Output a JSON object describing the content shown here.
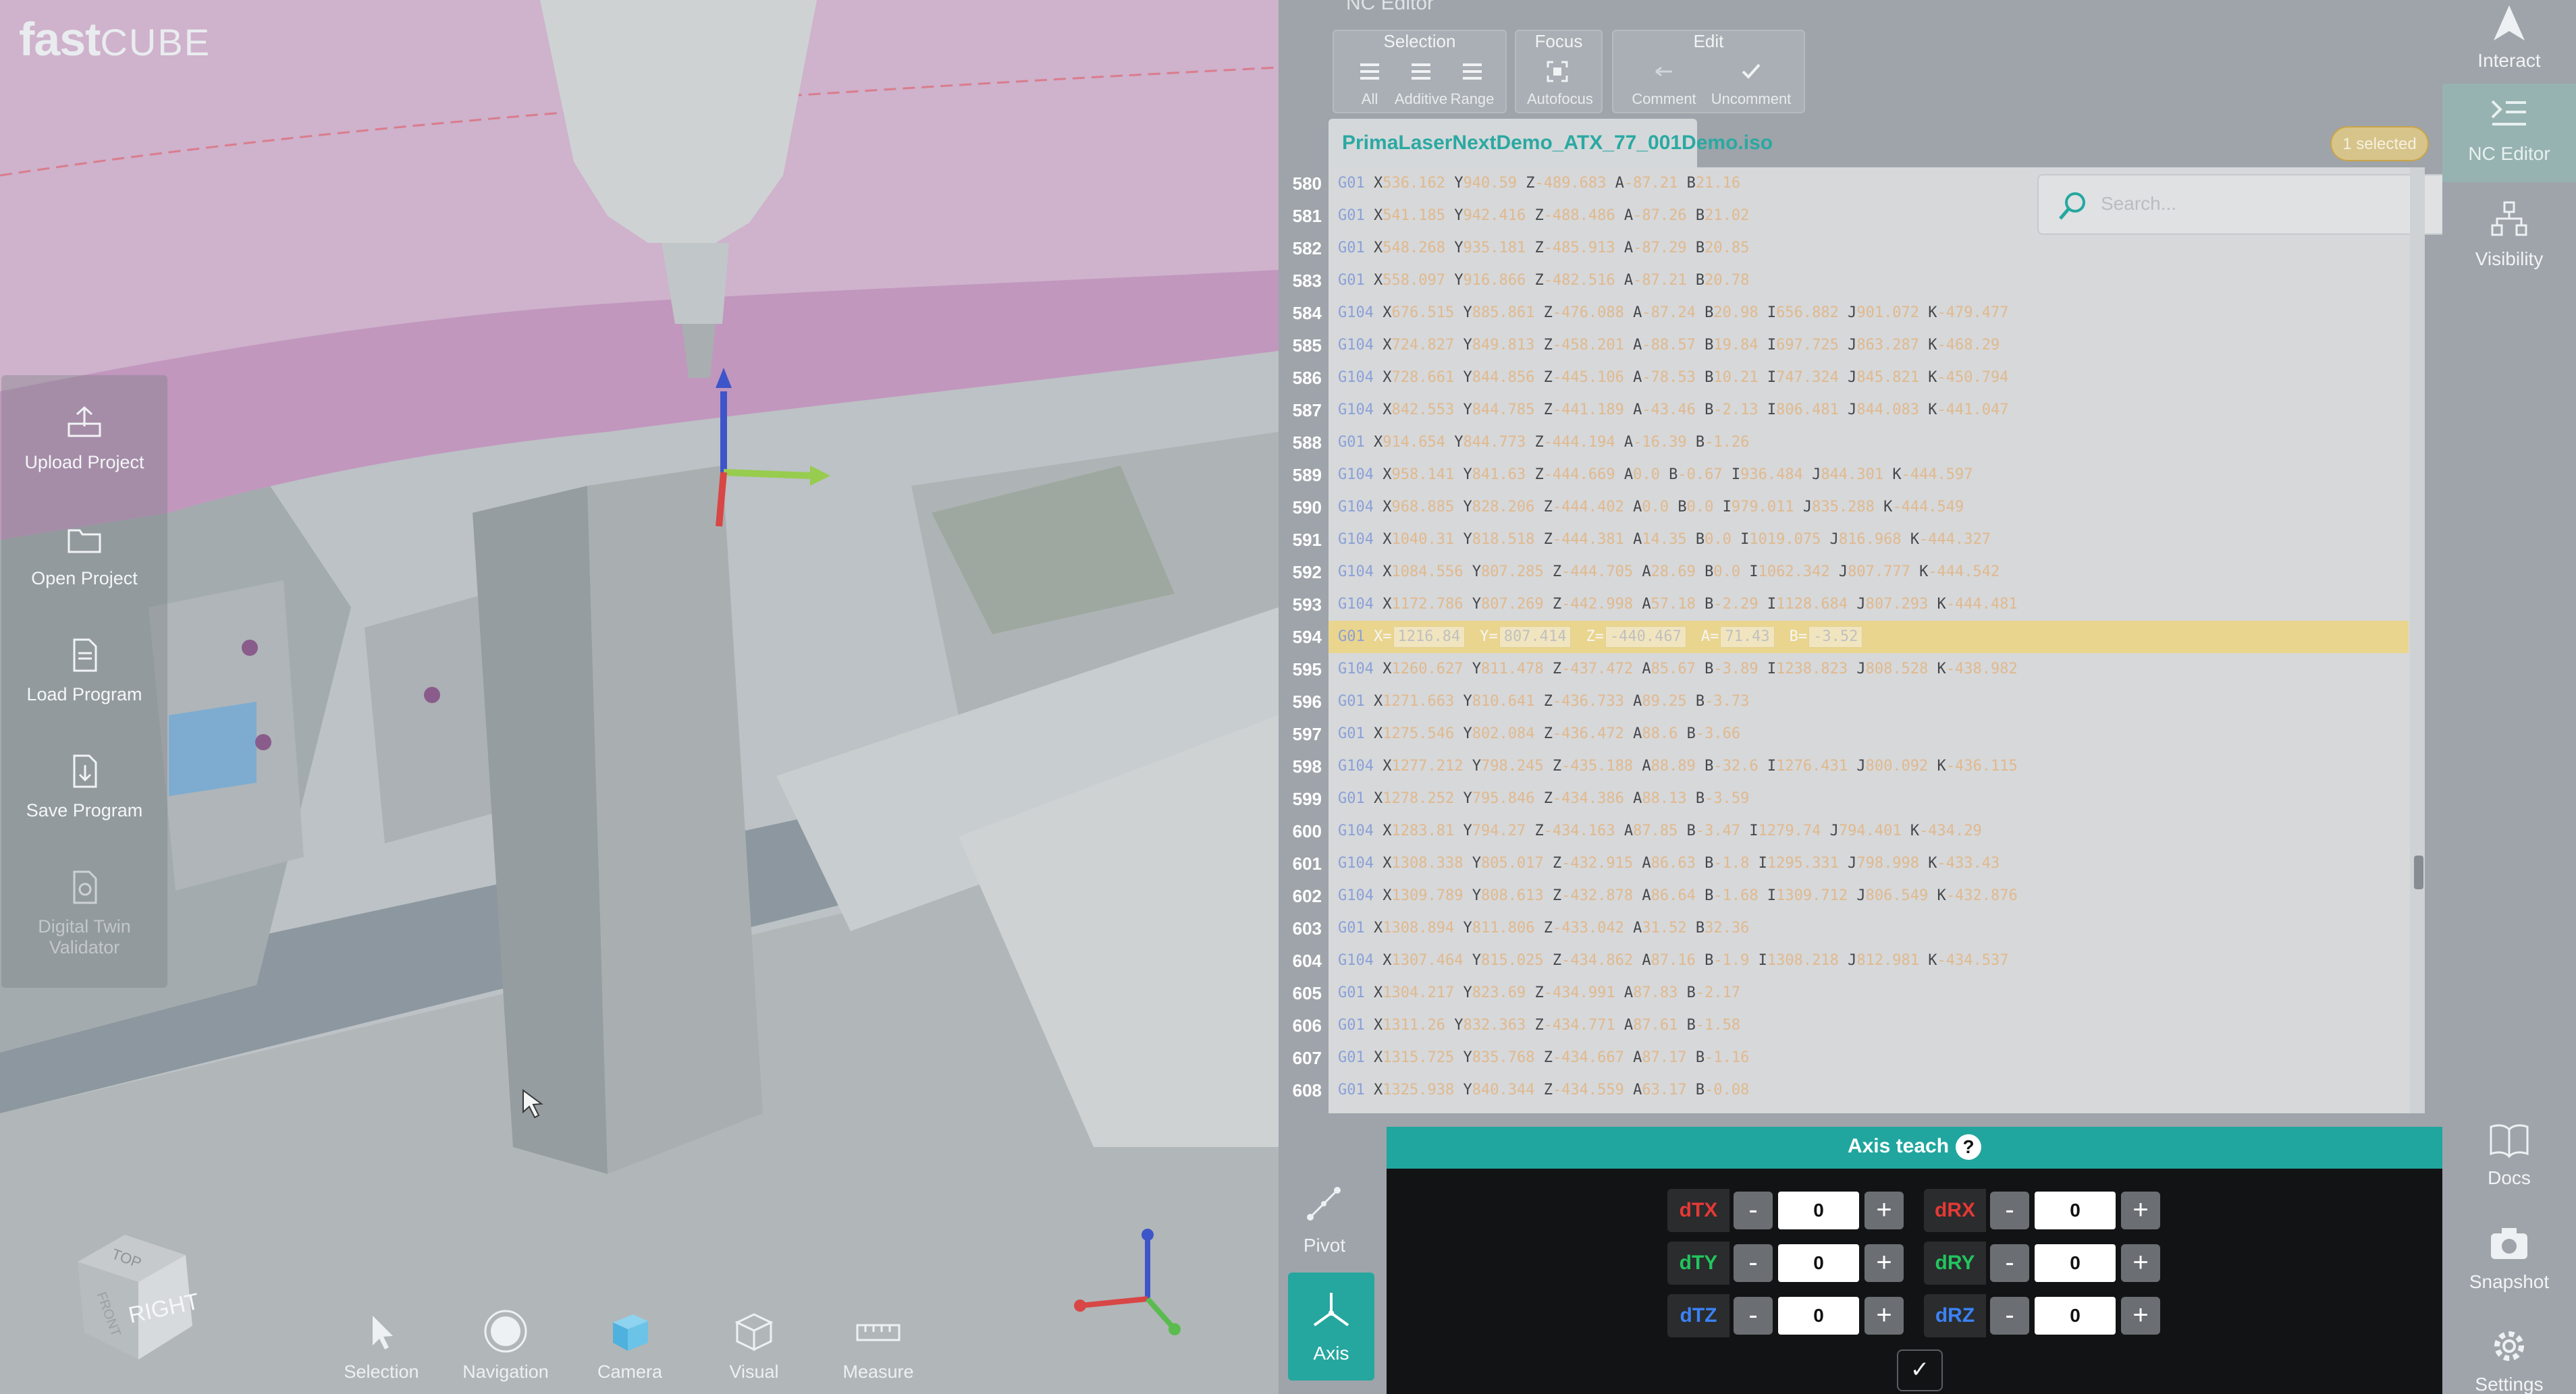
{
  "brand": {
    "name_left": "fast",
    "name_right": "CUBE"
  },
  "left_panel": [
    {
      "label": "Upload Project",
      "icon": "upload-project-icon"
    },
    {
      "label": "Open Project",
      "icon": "folder-icon"
    },
    {
      "label": "Load Program",
      "icon": "document-icon"
    },
    {
      "label": "Save Program",
      "icon": "save-program-icon"
    },
    {
      "label": "Digital Twin Validator",
      "icon": "digital-twin-icon"
    }
  ],
  "bottom_toolbar": [
    {
      "label": "Selection",
      "icon": "cursor-icon"
    },
    {
      "label": "Navigation",
      "icon": "navigation-icon"
    },
    {
      "label": "Camera",
      "icon": "camera-cube-icon"
    },
    {
      "label": "Visual",
      "icon": "visual-box-icon"
    },
    {
      "label": "Measure",
      "icon": "ruler-icon"
    }
  ],
  "nav_cube": {
    "face_front": "RIGHT",
    "face_top": "TOP",
    "face_side": "FRONT"
  },
  "nc_toolbar": {
    "title": "NC Editor",
    "groups": [
      {
        "title": "Selection",
        "buttons": [
          "All",
          "Additive",
          "Range"
        ]
      },
      {
        "title": "Focus",
        "buttons": [
          "Autofocus"
        ]
      },
      {
        "title": "Edit",
        "buttons": [
          "Comment",
          "Uncomment"
        ]
      }
    ]
  },
  "file_tab": "PrimaLaserNextDemo_ATX_77_001Demo.iso",
  "selected_badge": "1 selected",
  "search": {
    "placeholder": "Search..."
  },
  "code_lines": [
    {
      "n": "580",
      "g": "G01",
      "words": [
        [
          "X",
          "536.162"
        ],
        [
          "Y",
          "940.59"
        ],
        [
          "Z",
          "-489.683"
        ],
        [
          "A",
          "-87.21"
        ],
        [
          "B",
          "21.16"
        ]
      ]
    },
    {
      "n": "581",
      "g": "G01",
      "words": [
        [
          "X",
          "541.185"
        ],
        [
          "Y",
          "942.416"
        ],
        [
          "Z",
          "-488.486"
        ],
        [
          "A",
          "-87.26"
        ],
        [
          "B",
          "21.02"
        ]
      ]
    },
    {
      "n": "582",
      "g": "G01",
      "words": [
        [
          "X",
          "548.268"
        ],
        [
          "Y",
          "935.181"
        ],
        [
          "Z",
          "-485.913"
        ],
        [
          "A",
          "-87.29"
        ],
        [
          "B",
          "20.85"
        ]
      ]
    },
    {
      "n": "583",
      "g": "G01",
      "words": [
        [
          "X",
          "558.097"
        ],
        [
          "Y",
          "916.866"
        ],
        [
          "Z",
          "-482.516"
        ],
        [
          "A",
          "-87.21"
        ],
        [
          "B",
          "20.78"
        ]
      ]
    },
    {
      "n": "584",
      "g": "G104",
      "words": [
        [
          "X",
          "676.515"
        ],
        [
          "Y",
          "885.861"
        ],
        [
          "Z",
          "-476.088"
        ],
        [
          "A",
          "-87.24"
        ],
        [
          "B",
          "20.98"
        ],
        [
          "I",
          "656.882"
        ],
        [
          "J",
          "901.072"
        ],
        [
          "K",
          "-479.477"
        ]
      ]
    },
    {
      "n": "585",
      "g": "G104",
      "words": [
        [
          "X",
          "724.827"
        ],
        [
          "Y",
          "849.813"
        ],
        [
          "Z",
          "-458.201"
        ],
        [
          "A",
          "-88.57"
        ],
        [
          "B",
          "19.84"
        ],
        [
          "I",
          "697.725"
        ],
        [
          "J",
          "863.287"
        ],
        [
          "K",
          "-468.29"
        ]
      ]
    },
    {
      "n": "586",
      "g": "G104",
      "words": [
        [
          "X",
          "728.661"
        ],
        [
          "Y",
          "844.856"
        ],
        [
          "Z",
          "-445.106"
        ],
        [
          "A",
          "-78.53"
        ],
        [
          "B",
          "10.21"
        ],
        [
          "I",
          "747.324"
        ],
        [
          "J",
          "845.821"
        ],
        [
          "K",
          "-450.794"
        ]
      ]
    },
    {
      "n": "587",
      "g": "G104",
      "words": [
        [
          "X",
          "842.553"
        ],
        [
          "Y",
          "844.785"
        ],
        [
          "Z",
          "-441.189"
        ],
        [
          "A",
          "-43.46"
        ],
        [
          "B",
          "-2.13"
        ],
        [
          "I",
          "806.481"
        ],
        [
          "J",
          "844.083"
        ],
        [
          "K",
          "-441.047"
        ]
      ]
    },
    {
      "n": "588",
      "g": "G01",
      "words": [
        [
          "X",
          "914.654"
        ],
        [
          "Y",
          "844.773"
        ],
        [
          "Z",
          "-444.194"
        ],
        [
          "A",
          "-16.39"
        ],
        [
          "B",
          "-1.26"
        ]
      ]
    },
    {
      "n": "589",
      "g": "G104",
      "words": [
        [
          "X",
          "958.141"
        ],
        [
          "Y",
          "841.63"
        ],
        [
          "Z",
          "-444.669"
        ],
        [
          "A",
          "0.0"
        ],
        [
          "B",
          "-0.67"
        ],
        [
          "I",
          "936.484"
        ],
        [
          "J",
          "844.301"
        ],
        [
          "K",
          "-444.597"
        ]
      ]
    },
    {
      "n": "590",
      "g": "G104",
      "words": [
        [
          "X",
          "968.885"
        ],
        [
          "Y",
          "828.206"
        ],
        [
          "Z",
          "-444.402"
        ],
        [
          "A",
          "0.0"
        ],
        [
          "B",
          "0.0"
        ],
        [
          "I",
          "979.011"
        ],
        [
          "J",
          "835.288"
        ],
        [
          "K",
          "-444.549"
        ]
      ]
    },
    {
      "n": "591",
      "g": "G104",
      "words": [
        [
          "X",
          "1040.31"
        ],
        [
          "Y",
          "818.518"
        ],
        [
          "Z",
          "-444.381"
        ],
        [
          "A",
          "14.35"
        ],
        [
          "B",
          "0.0"
        ],
        [
          "I",
          "1019.075"
        ],
        [
          "J",
          "816.968"
        ],
        [
          "K",
          "-444.327"
        ]
      ]
    },
    {
      "n": "592",
      "g": "G104",
      "words": [
        [
          "X",
          "1084.556"
        ],
        [
          "Y",
          "807.285"
        ],
        [
          "Z",
          "-444.705"
        ],
        [
          "A",
          "28.69"
        ],
        [
          "B",
          "0.0"
        ],
        [
          "I",
          "1062.342"
        ],
        [
          "J",
          "807.777"
        ],
        [
          "K",
          "-444.542"
        ]
      ]
    },
    {
      "n": "593",
      "g": "G104",
      "words": [
        [
          "X",
          "1172.786"
        ],
        [
          "Y",
          "807.269"
        ],
        [
          "Z",
          "-442.998"
        ],
        [
          "A",
          "57.18"
        ],
        [
          "B",
          "-2.29"
        ],
        [
          "I",
          "1128.684"
        ],
        [
          "J",
          "807.293"
        ],
        [
          "K",
          "-444.481"
        ]
      ]
    },
    {
      "n": "594",
      "g": "G01",
      "highlight": true,
      "words": [
        [
          "X",
          "1216.84"
        ],
        [
          "Y",
          "807.414"
        ],
        [
          "Z",
          "-440.467"
        ],
        [
          "A",
          "71.43"
        ],
        [
          "B",
          "-3.52"
        ]
      ]
    },
    {
      "n": "595",
      "g": "G104",
      "words": [
        [
          "X",
          "1260.627"
        ],
        [
          "Y",
          "811.478"
        ],
        [
          "Z",
          "-437.472"
        ],
        [
          "A",
          "85.67"
        ],
        [
          "B",
          "-3.89"
        ],
        [
          "I",
          "1238.823"
        ],
        [
          "J",
          "808.528"
        ],
        [
          "K",
          "-438.982"
        ]
      ]
    },
    {
      "n": "596",
      "g": "G01",
      "words": [
        [
          "X",
          "1271.663"
        ],
        [
          "Y",
          "810.641"
        ],
        [
          "Z",
          "-436.733"
        ],
        [
          "A",
          "89.25"
        ],
        [
          "B",
          "-3.73"
        ]
      ]
    },
    {
      "n": "597",
      "g": "G01",
      "words": [
        [
          "X",
          "1275.546"
        ],
        [
          "Y",
          "802.084"
        ],
        [
          "Z",
          "-436.472"
        ],
        [
          "A",
          "88.6"
        ],
        [
          "B",
          "-3.66"
        ]
      ]
    },
    {
      "n": "598",
      "g": "G104",
      "words": [
        [
          "X",
          "1277.212"
        ],
        [
          "Y",
          "798.245"
        ],
        [
          "Z",
          "-435.188"
        ],
        [
          "A",
          "88.89"
        ],
        [
          "B",
          "-32.6"
        ],
        [
          "I",
          "1276.431"
        ],
        [
          "J",
          "800.092"
        ],
        [
          "K",
          "-436.115"
        ]
      ]
    },
    {
      "n": "599",
      "g": "G01",
      "words": [
        [
          "X",
          "1278.252"
        ],
        [
          "Y",
          "795.846"
        ],
        [
          "Z",
          "-434.386"
        ],
        [
          "A",
          "88.13"
        ],
        [
          "B",
          "-3.59"
        ]
      ]
    },
    {
      "n": "600",
      "g": "G104",
      "words": [
        [
          "X",
          "1283.81"
        ],
        [
          "Y",
          "794.27"
        ],
        [
          "Z",
          "-434.163"
        ],
        [
          "A",
          "87.85"
        ],
        [
          "B",
          "-3.47"
        ],
        [
          "I",
          "1279.74"
        ],
        [
          "J",
          "794.401"
        ],
        [
          "K",
          "-434.29"
        ]
      ]
    },
    {
      "n": "601",
      "g": "G104",
      "words": [
        [
          "X",
          "1308.338"
        ],
        [
          "Y",
          "805.017"
        ],
        [
          "Z",
          "-432.915"
        ],
        [
          "A",
          "86.63"
        ],
        [
          "B",
          "-1.8"
        ],
        [
          "I",
          "1295.331"
        ],
        [
          "J",
          "798.998"
        ],
        [
          "K",
          "-433.43"
        ]
      ]
    },
    {
      "n": "602",
      "g": "G104",
      "words": [
        [
          "X",
          "1309.789"
        ],
        [
          "Y",
          "808.613"
        ],
        [
          "Z",
          "-432.878"
        ],
        [
          "A",
          "86.64"
        ],
        [
          "B",
          "-1.68"
        ],
        [
          "I",
          "1309.712"
        ],
        [
          "J",
          "806.549"
        ],
        [
          "K",
          "-432.876"
        ]
      ]
    },
    {
      "n": "603",
      "g": "G01",
      "words": [
        [
          "X",
          "1308.894"
        ],
        [
          "Y",
          "811.806"
        ],
        [
          "Z",
          "-433.042"
        ],
        [
          "A",
          "31.52"
        ],
        [
          "B",
          "32.36"
        ]
      ]
    },
    {
      "n": "604",
      "g": "G104",
      "words": [
        [
          "X",
          "1307.464"
        ],
        [
          "Y",
          "815.025"
        ],
        [
          "Z",
          "-434.862"
        ],
        [
          "A",
          "87.16"
        ],
        [
          "B",
          "-1.9"
        ],
        [
          "I",
          "1308.218"
        ],
        [
          "J",
          "812.981"
        ],
        [
          "K",
          "-434.537"
        ]
      ]
    },
    {
      "n": "605",
      "g": "G01",
      "words": [
        [
          "X",
          "1304.217"
        ],
        [
          "Y",
          "823.69"
        ],
        [
          "Z",
          "-434.991"
        ],
        [
          "A",
          "87.83"
        ],
        [
          "B",
          "-2.17"
        ]
      ]
    },
    {
      "n": "606",
      "g": "G01",
      "words": [
        [
          "X",
          "1311.26"
        ],
        [
          "Y",
          "832.363"
        ],
        [
          "Z",
          "-434.771"
        ],
        [
          "A",
          "87.61"
        ],
        [
          "B",
          "-1.58"
        ]
      ]
    },
    {
      "n": "607",
      "g": "G01",
      "words": [
        [
          "X",
          "1315.725"
        ],
        [
          "Y",
          "835.768"
        ],
        [
          "Z",
          "-434.667"
        ],
        [
          "A",
          "87.17"
        ],
        [
          "B",
          "-1.16"
        ]
      ]
    },
    {
      "n": "608",
      "g": "G01",
      "words": [
        [
          "X",
          "1325.938"
        ],
        [
          "Y",
          "840.344"
        ],
        [
          "Z",
          "-434.559"
        ],
        [
          "A",
          "63.17"
        ],
        [
          "B",
          "-0.08"
        ]
      ]
    }
  ],
  "highlight_fields": {
    "X": "X=",
    "Y": "Y=",
    "Z": "Z=",
    "A": "A=",
    "B": "B="
  },
  "right_rail": [
    {
      "label": "Interact",
      "icon": "interact-icon"
    },
    {
      "label": "NC Editor",
      "icon": "nc-editor-icon",
      "active": true
    },
    {
      "label": "Visibility",
      "icon": "visibility-icon"
    },
    {
      "label": "Docs",
      "icon": "book-icon"
    },
    {
      "label": "Snapshot",
      "icon": "camera-icon"
    },
    {
      "label": "Settings",
      "icon": "gear-icon"
    }
  ],
  "modes": {
    "pivot": "Pivot",
    "axis": "Axis"
  },
  "axis_teach": {
    "title": "Axis teach",
    "help": "?",
    "controls": [
      {
        "label": "dTX",
        "value": "0",
        "color": "#e53935"
      },
      {
        "label": "dRX",
        "value": "0",
        "color": "#e53935"
      },
      {
        "label": "dTY",
        "value": "0",
        "color": "#22c55e"
      },
      {
        "label": "dRY",
        "value": "0",
        "color": "#22c55e"
      },
      {
        "label": "dTZ",
        "value": "0",
        "color": "#3b82f6"
      },
      {
        "label": "dRZ",
        "value": "0",
        "color": "#3b82f6"
      }
    ],
    "minus": "-",
    "plus": "+",
    "confirm": "✓"
  },
  "colors": {
    "accent": "#25a79f",
    "highlight_line": "#ead58f"
  }
}
